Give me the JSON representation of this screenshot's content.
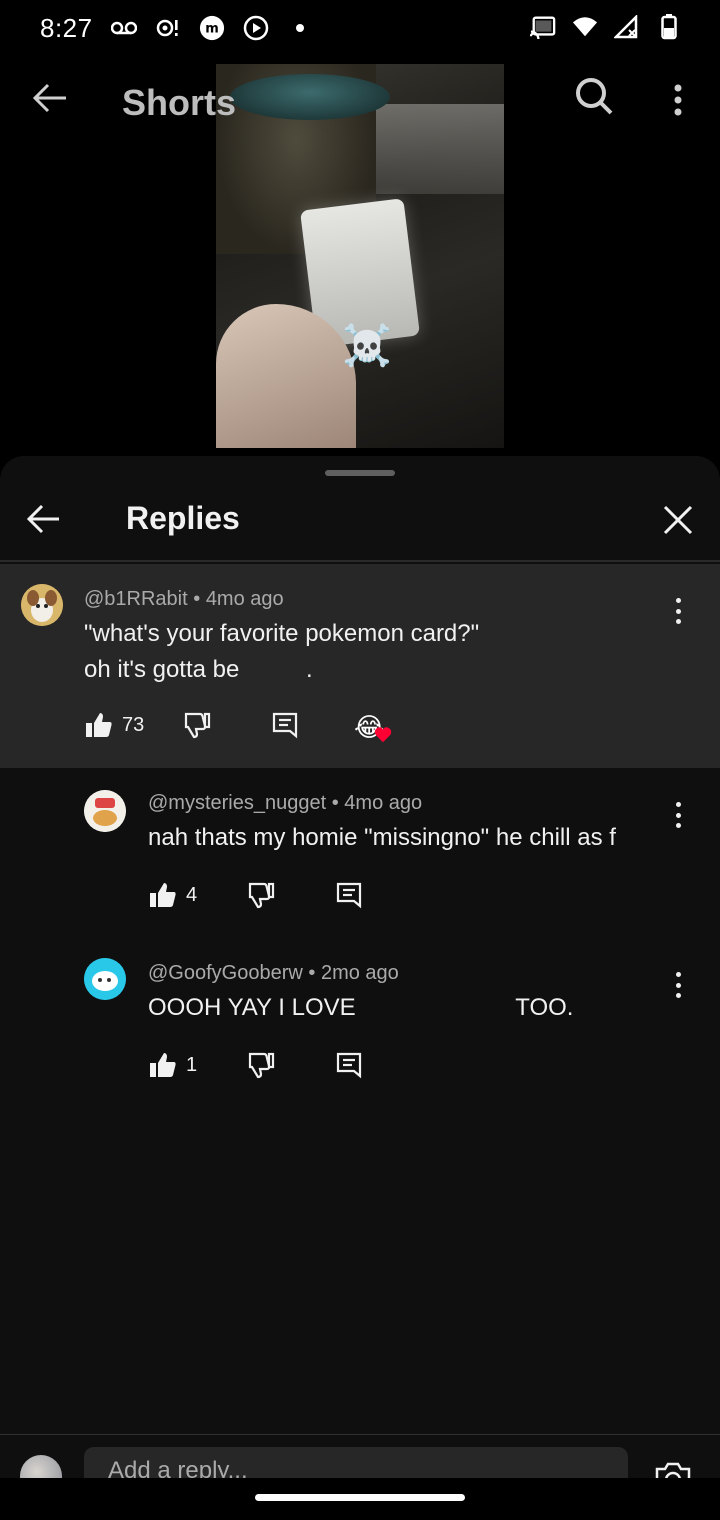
{
  "status_bar": {
    "time": "8:27",
    "left_icons": [
      "voicemail-icon",
      "notification-icon",
      "m-app-icon",
      "play-circle-icon",
      "dot-icon"
    ],
    "right_icons": [
      "cast-icon",
      "wifi-icon",
      "signal-icon",
      "battery-icon"
    ]
  },
  "top_nav": {
    "title": "Shorts"
  },
  "video": {
    "emoji": "☠️"
  },
  "sheet": {
    "title": "Replies"
  },
  "parent_comment": {
    "handle": "@b1RRabit",
    "age": "4mo ago",
    "line1": "\"what's your favorite pokemon card?\"",
    "line2": "oh it's gotta be          .",
    "likes": "73",
    "creator_heart_emoji": "😂"
  },
  "replies": [
    {
      "handle": "@mysteries_nugget",
      "age": "4mo ago",
      "text": "nah thats my homie \"missingno\" he chill as f",
      "likes": "4"
    },
    {
      "handle": "@GoofyGooberw",
      "age": "2mo ago",
      "text": "OOOH YAY I LOVE                        TOO.",
      "likes": "1"
    }
  ],
  "reply_bar": {
    "placeholder": "Add a reply..."
  },
  "colors": {
    "background": "#0f0f0f",
    "highlight": "#272727",
    "text": "#f1f1f1",
    "meta": "#aaaaaa",
    "heart": "#ff0033"
  }
}
